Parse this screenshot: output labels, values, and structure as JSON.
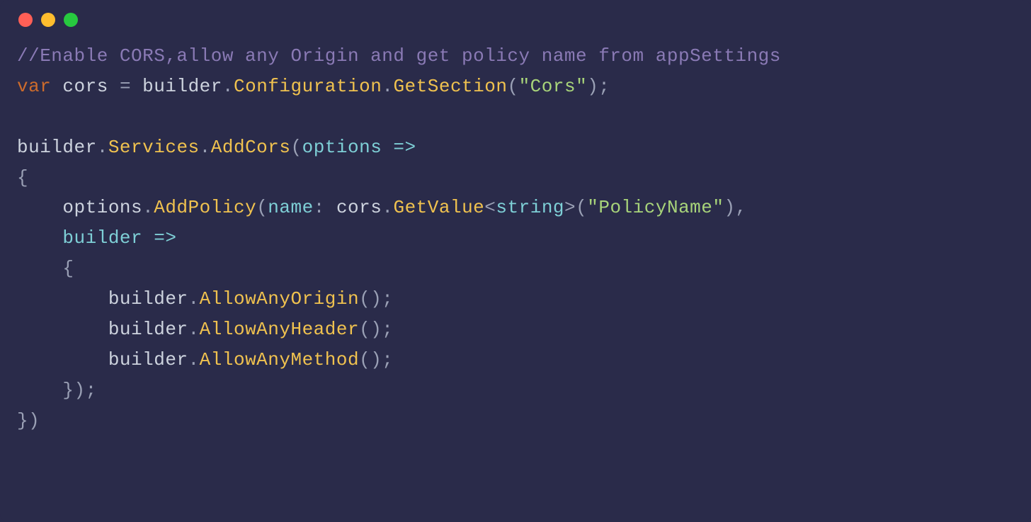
{
  "code": {
    "l1_comment": "//Enable CORS,allow any Origin and get policy name from appSettings",
    "l2_var": "var",
    "l2_cors": "cors",
    "l2_eq": " = ",
    "l2_builder": "builder",
    "l2_dot1": ".",
    "l2_config": "Configuration",
    "l2_dot2": ".",
    "l2_getsection": "GetSection",
    "l2_paren_open": "(",
    "l2_str": "\"Cors\"",
    "l2_close": ");",
    "l4_builder": "builder",
    "l4_dot1": ".",
    "l4_services": "Services",
    "l4_dot2": ".",
    "l4_addcors": "AddCors",
    "l4_paren_open": "(",
    "l4_options": "options",
    "l4_arrow": " =>",
    "l5_brace": "{",
    "l6_indent": "    ",
    "l6_options": "options",
    "l6_dot": ".",
    "l6_addpolicy": "AddPolicy",
    "l6_paren_open": "(",
    "l6_name": "name",
    "l6_colon": ": ",
    "l6_cors": "cors",
    "l6_dot2": ".",
    "l6_getvalue": "GetValue",
    "l6_lt": "<",
    "l6_string_type": "string",
    "l6_gt": ">",
    "l6_paren2": "(",
    "l6_str": "\"PolicyName\"",
    "l6_close": "),",
    "l7_indent": "    ",
    "l7_builder": "builder",
    "l7_arrow": " =>",
    "l8_indent": "    ",
    "l8_brace": "{",
    "l9_indent": "        ",
    "l9_builder": "builder",
    "l9_dot": ".",
    "l9_method": "AllowAnyOrigin",
    "l9_paren": "();",
    "l10_indent": "        ",
    "l10_builder": "builder",
    "l10_dot": ".",
    "l10_method": "AllowAnyHeader",
    "l10_paren": "();",
    "l11_indent": "        ",
    "l11_builder": "builder",
    "l11_dot": ".",
    "l11_method": "AllowAnyMethod",
    "l11_paren": "();",
    "l12_indent": "    ",
    "l12_close": "});",
    "l13_close": "})"
  }
}
